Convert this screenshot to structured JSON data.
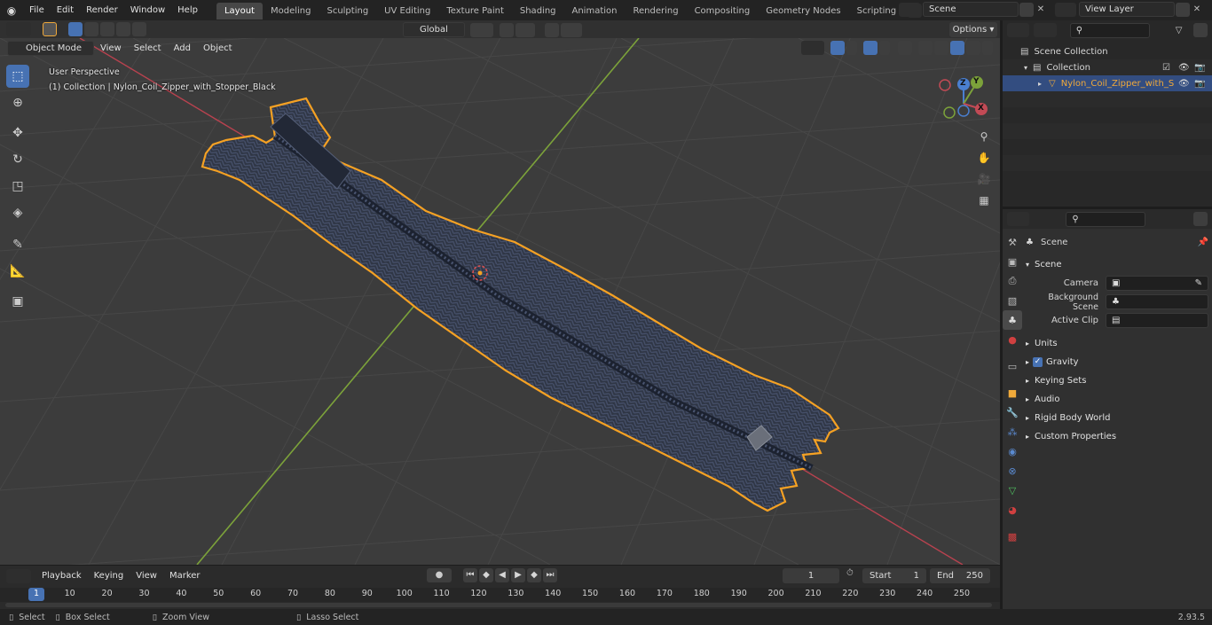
{
  "topbar": {
    "menus": [
      "File",
      "Edit",
      "Render",
      "Window",
      "Help"
    ],
    "workspaces": [
      "Layout",
      "Modeling",
      "Sculpting",
      "UV Editing",
      "Texture Paint",
      "Shading",
      "Animation",
      "Rendering",
      "Compositing",
      "Geometry Nodes",
      "Scripting"
    ],
    "active_workspace": "Layout",
    "scene_name": "Scene",
    "view_layer": "View Layer"
  },
  "viewport": {
    "transform_orientation": "Global",
    "options_label": "Options",
    "mode": "Object Mode",
    "menus": [
      "View",
      "Select",
      "Add",
      "Object"
    ],
    "perspective_label": "User Perspective",
    "object_label": "(1) Collection | Nylon_Coil_Zipper_with_Stopper_Black",
    "gizmo_axes": {
      "x": "X",
      "y": "Y",
      "z": "Z"
    }
  },
  "outliner": {
    "scene_collection": "Scene Collection",
    "collection": "Collection",
    "object": "Nylon_Coil_Zipper_with_S"
  },
  "properties": {
    "context_name": "Scene",
    "panel_scene": "Scene",
    "camera_label": "Camera",
    "background_scene_label": "Background Scene",
    "active_clip_label": "Active Clip",
    "subpanels": [
      "Units",
      "Gravity",
      "Keying Sets",
      "Audio",
      "Rigid Body World",
      "Custom Properties"
    ]
  },
  "timeline": {
    "menus": [
      "Playback",
      "Keying",
      "View",
      "Marker"
    ],
    "current_frame": "1",
    "start_label": "Start",
    "start_value": "1",
    "end_label": "End",
    "end_value": "250",
    "ticks": [
      "1",
      "10",
      "20",
      "30",
      "40",
      "50",
      "60",
      "70",
      "80",
      "90",
      "100",
      "110",
      "120",
      "130",
      "140",
      "150",
      "160",
      "170",
      "180",
      "190",
      "200",
      "210",
      "220",
      "230",
      "240",
      "250"
    ]
  },
  "statusbar": {
    "select": "Select",
    "box_select": "Box Select",
    "zoom_view": "Zoom View",
    "lasso_select": "Lasso Select",
    "version": "2.93.5"
  },
  "colors": {
    "accent": "#4772b3",
    "selection_outline": "#f5a123",
    "x_axis": "#b8424f",
    "y_axis": "#7ca23a"
  }
}
